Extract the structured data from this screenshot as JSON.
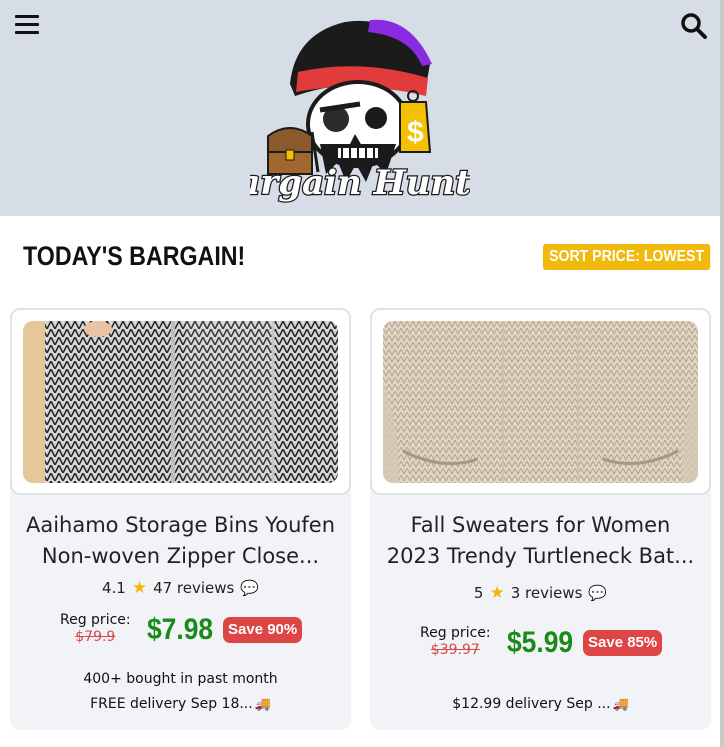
{
  "brand": {
    "name": "Bargain Hunter",
    "colors": {
      "header_bg": "#d6dde7",
      "accent": "#f2b90d",
      "price_green": "#1a8b1a",
      "save_red": "#de4545"
    }
  },
  "header": {
    "menu_icon": "hamburger-icon",
    "search_icon": "search-icon"
  },
  "section": {
    "title": "TODAY'S BARGAIN!",
    "sort_label": "SORT PRICE: LOWEST"
  },
  "products": [
    {
      "title_line1": "Aaihamo Storage Bins Youfen",
      "title_line2": "Non-woven Zipper Close...",
      "rating": "4.1",
      "reviews": "47 reviews",
      "reg_label": "Reg price:",
      "reg_price": "$79.9",
      "price": "$7.98",
      "save": "Save 90%",
      "bought": "400+ bought in past month",
      "delivery": "FREE delivery Sep 18...",
      "image_desc": "herringbone-storage-bins"
    },
    {
      "title_line1": "Fall Sweaters for Women",
      "title_line2": "2023 Trendy Turtleneck Bat...",
      "rating": "5",
      "reviews": "3 reviews",
      "reg_label": "Reg price:",
      "reg_price": "$39.97",
      "price": "$5.99",
      "save": "Save 85%",
      "bought": "",
      "delivery": "$12.99 delivery Sep ...",
      "image_desc": "beige-knit-sweater"
    }
  ]
}
